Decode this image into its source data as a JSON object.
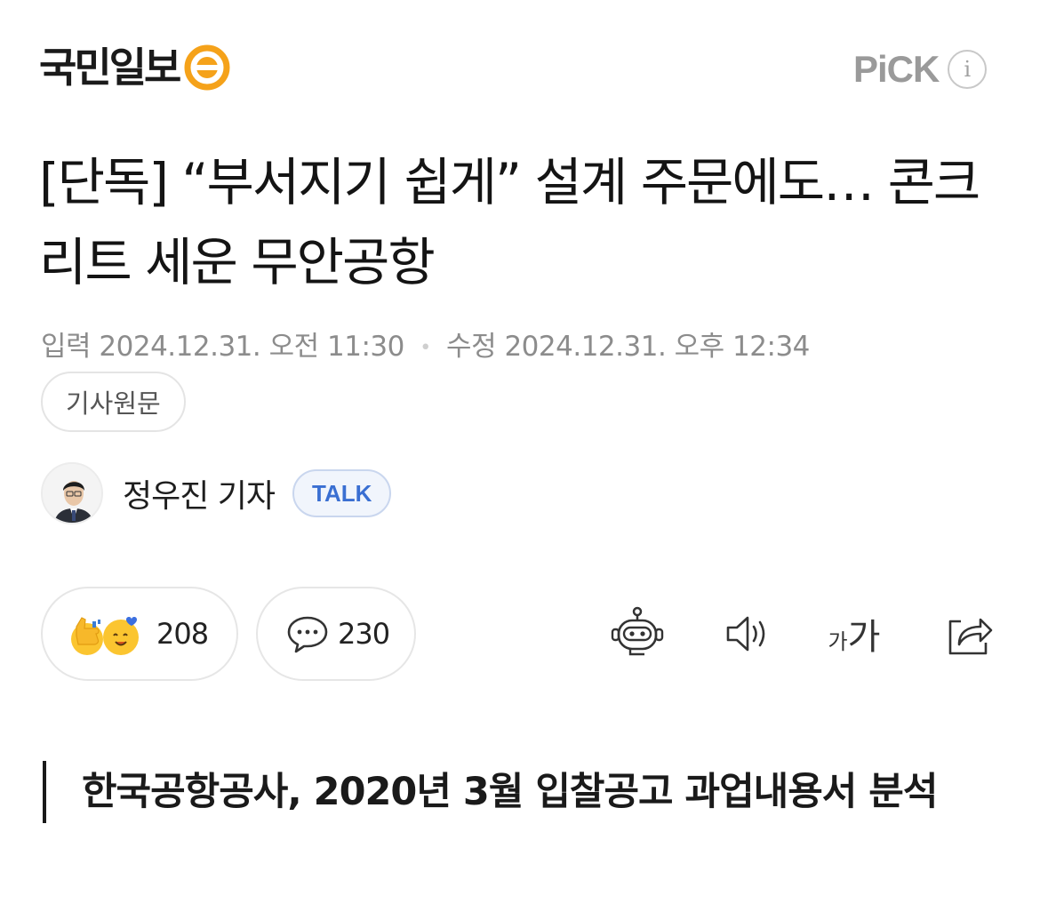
{
  "header": {
    "press_name": "국민일보",
    "pick_label": "PiCK",
    "info_glyph": "i",
    "logo_color": "#f5a21a"
  },
  "article": {
    "headline": "[단독] “부서지기 쉽게” 설계 주문에도… 콘크리트 세운 무안공항",
    "input_label": "입력",
    "input_datetime": "2024.12.31. 오전 11:30",
    "separator": "•",
    "modified_label": "수정",
    "modified_datetime": "2024.12.31. 오후 12:34",
    "original_button_label": "기사원문",
    "subheading": "한국공항공사, 2020년 3월 입찰공고 과업내용서 분석"
  },
  "reporter": {
    "name": "정우진 기자",
    "talk_label": "TALK"
  },
  "reactions": {
    "like_count": "208",
    "comment_count": "230"
  },
  "tools": {
    "fontsize_small": "가",
    "fontsize_big": "가",
    "icons": [
      "robot-summary-icon",
      "speaker-icon",
      "font-size-icon",
      "share-icon"
    ]
  },
  "colors": {
    "talk_text": "#3a6fd2",
    "meta_text": "#8c8c8c",
    "emoji_yellow": "#fbc530"
  }
}
